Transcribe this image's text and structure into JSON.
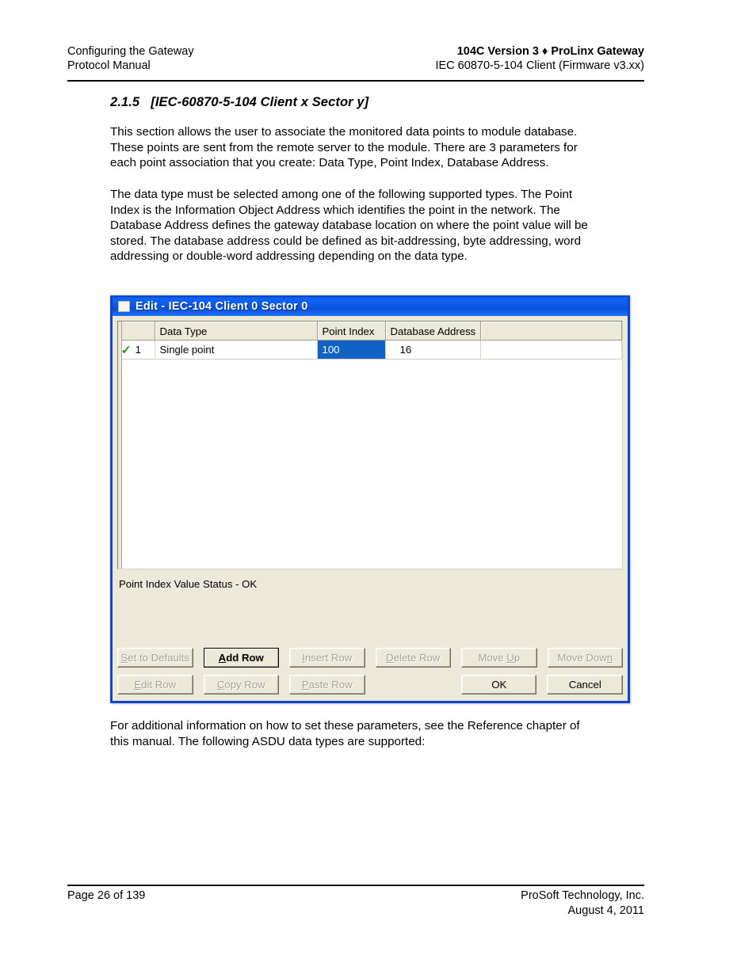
{
  "header": {
    "left_line1": "Configuring the  Gateway",
    "left_line2": "Protocol Manual",
    "right_line1": "104C Version 3 ♦ ProLinx Gateway",
    "right_line2": "IEC 60870-5-104 Client (Firmware v3.xx)"
  },
  "content": {
    "section_number": "2.1.5",
    "section_title": "[IEC-60870-5-104 Client x Sector y]",
    "paragraph_1": "This section allows the user to associate the monitored data points to module database.  These points are sent from the remote server to the module. There are 3 parameters for each point association that you create: Data Type, Point Index, Database Address.",
    "paragraph_2": "The data type must be selected among one of the following supported types. The Point Index is the Information Object Address which identifies the point in the network. The Database Address  defines the gateway database location on where the point value will be stored. The database address could be defined as bit-addressing, byte addressing, word addressing or double-word addressing depending on the data type.",
    "paragraph_3": "For additional information on how to set these parameters, see the Reference chapter of this manual. The following ASDU data types are supported:"
  },
  "dialog": {
    "title": "Edit - IEC-104 Client 0 Sector 0",
    "title_icon": "window-square-icon",
    "accent_color": "#0a46d2",
    "face_color": "#ece9d8",
    "selection_color": "#1062c4",
    "check_color": "#13a013",
    "grid": {
      "columns": [
        "",
        "Data Type",
        "Point Index",
        "Database Address",
        ""
      ],
      "rows": [
        {
          "status_icon": "check-icon",
          "number": "1",
          "data_type": "Single point",
          "point_index": "100",
          "point_index_selected": true,
          "database_address": "16"
        }
      ]
    },
    "status_text": "Point Index Value Status - OK",
    "buttons_row1": [
      {
        "label": "Set to Defaults",
        "accel": "S",
        "enabled": false,
        "default": false
      },
      {
        "label": "Add Row",
        "accel": "A",
        "enabled": true,
        "default": true
      },
      {
        "label": "Insert Row",
        "accel": "I",
        "enabled": false,
        "default": false
      },
      {
        "label": "Delete Row",
        "accel": "D",
        "enabled": false,
        "default": false
      },
      {
        "label": "Move Up",
        "accel": "U",
        "enabled": false,
        "default": false
      },
      {
        "label": "Move Down",
        "accel": "n",
        "enabled": false,
        "default": false
      }
    ],
    "buttons_row2": [
      {
        "label": "Edit Row",
        "accel": "E",
        "enabled": false,
        "default": false
      },
      {
        "label": "Copy Row",
        "accel": "C",
        "enabled": false,
        "default": false
      },
      {
        "label": "Paste Row",
        "accel": "P",
        "enabled": false,
        "default": false
      },
      {
        "label": "OK",
        "accel": "",
        "enabled": true,
        "default": false
      },
      {
        "label": "Cancel",
        "accel": "",
        "enabled": true,
        "default": false
      }
    ]
  },
  "footer": {
    "left": "Page 26 of 139",
    "right_line1": "ProSoft Technology, Inc.",
    "right_line2": "August 4, 2011"
  }
}
